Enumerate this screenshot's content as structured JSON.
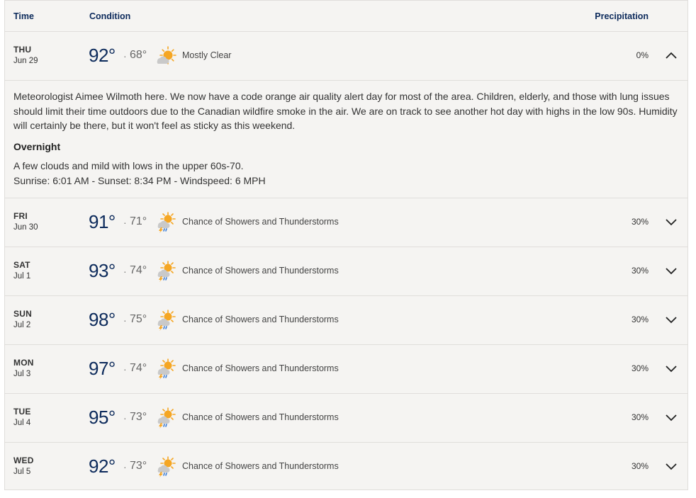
{
  "header": {
    "time": "Time",
    "condition": "Condition",
    "precipitation": "Precipitation"
  },
  "expanded": {
    "day": "THU",
    "date": "Jun 29",
    "high": "92°",
    "low": "68°",
    "condition": "Mostly Clear",
    "precip": "0%",
    "icon": "sun-cloud-icon",
    "description": "Meteorologist Aimee Wilmoth here. We now have a code orange air quality alert day for most of the area. Children, elderly, and those with lung issues should limit their time outdoors due to the Canadian wildfire smoke in the air. We are on track to see another hot day with highs in the low 90s. Humidity will certainly be there, but it won't feel as sticky as this weekend.",
    "overnight_title": "Overnight",
    "overnight_text": "A few clouds and mild with lows in the upper 60s-70.",
    "sun_info": "Sunrise: 6:01 AM - Sunset: 8:34 PM - Windspeed: 6 MPH"
  },
  "days": [
    {
      "day": "FRI",
      "date": "Jun 30",
      "high": "91°",
      "low": "71°",
      "condition": "Chance of Showers and Thunderstorms",
      "precip": "30%",
      "icon": "thunderstorm-icon"
    },
    {
      "day": "SAT",
      "date": "Jul 1",
      "high": "93°",
      "low": "74°",
      "condition": "Chance of Showers and Thunderstorms",
      "precip": "30%",
      "icon": "thunderstorm-icon"
    },
    {
      "day": "SUN",
      "date": "Jul 2",
      "high": "98°",
      "low": "75°",
      "condition": "Chance of Showers and Thunderstorms",
      "precip": "30%",
      "icon": "thunderstorm-icon"
    },
    {
      "day": "MON",
      "date": "Jul 3",
      "high": "97°",
      "low": "74°",
      "condition": "Chance of Showers and Thunderstorms",
      "precip": "30%",
      "icon": "thunderstorm-icon"
    },
    {
      "day": "TUE",
      "date": "Jul 4",
      "high": "95°",
      "low": "73°",
      "condition": "Chance of Showers and Thunderstorms",
      "precip": "30%",
      "icon": "thunderstorm-icon"
    },
    {
      "day": "WED",
      "date": "Jul 5",
      "high": "92°",
      "low": "73°",
      "condition": "Chance of Showers and Thunderstorms",
      "precip": "30%",
      "icon": "thunderstorm-icon"
    }
  ],
  "colors": {
    "accent": "#0c2a5b",
    "sun": "#f5a623",
    "cloud": "#b8b8b8",
    "bolt": "#f5a623",
    "rain": "#3b7dd8"
  }
}
